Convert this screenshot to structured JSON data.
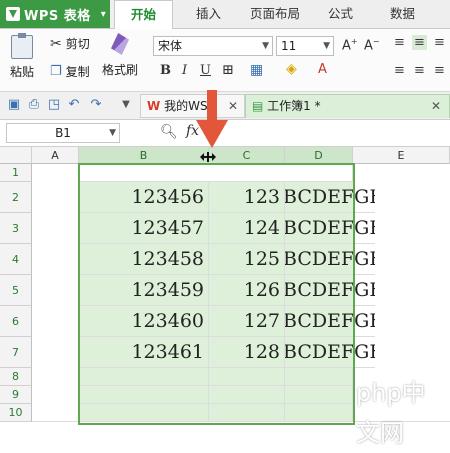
{
  "app": {
    "title": "WPS 表格"
  },
  "menu": {
    "tabs": [
      "开始",
      "插入",
      "页面布局",
      "公式",
      "数据"
    ]
  },
  "ribbon": {
    "paste": "粘贴",
    "cut": "剪切",
    "copy": "复制",
    "format_painter": "格式刷",
    "font_name": "宋体",
    "font_size": "11",
    "bold": "B",
    "italic": "I",
    "underline": "U"
  },
  "doc_tabs": {
    "tab1": "我的W",
    "tab1_suffix": "S",
    "tab2": "工作簿1 *"
  },
  "formula_bar": {
    "name_box": "B1",
    "fx": "fx"
  },
  "grid": {
    "columns": [
      "A",
      "B",
      "C",
      "D",
      "E"
    ],
    "rows": [
      "1",
      "2",
      "3",
      "4",
      "5",
      "6",
      "7",
      "8",
      "9",
      "10"
    ],
    "data": [
      {
        "b": "",
        "c": "",
        "d": ""
      },
      {
        "b": "123456",
        "c": "123",
        "d": "BCDEFGH"
      },
      {
        "b": "123457",
        "c": "124",
        "d": "BCDEFGH"
      },
      {
        "b": "123458",
        "c": "125",
        "d": "BCDEFGH"
      },
      {
        "b": "123459",
        "c": "126",
        "d": "BCDEFGH"
      },
      {
        "b": "123460",
        "c": "127",
        "d": "BCDEFGH"
      },
      {
        "b": "123461",
        "c": "128",
        "d": "BCDEFGH"
      }
    ]
  },
  "watermark": "php中文网",
  "colors": {
    "accent": "#3c9a45",
    "selection": "#dff0da",
    "arrow": "#e2573a"
  }
}
